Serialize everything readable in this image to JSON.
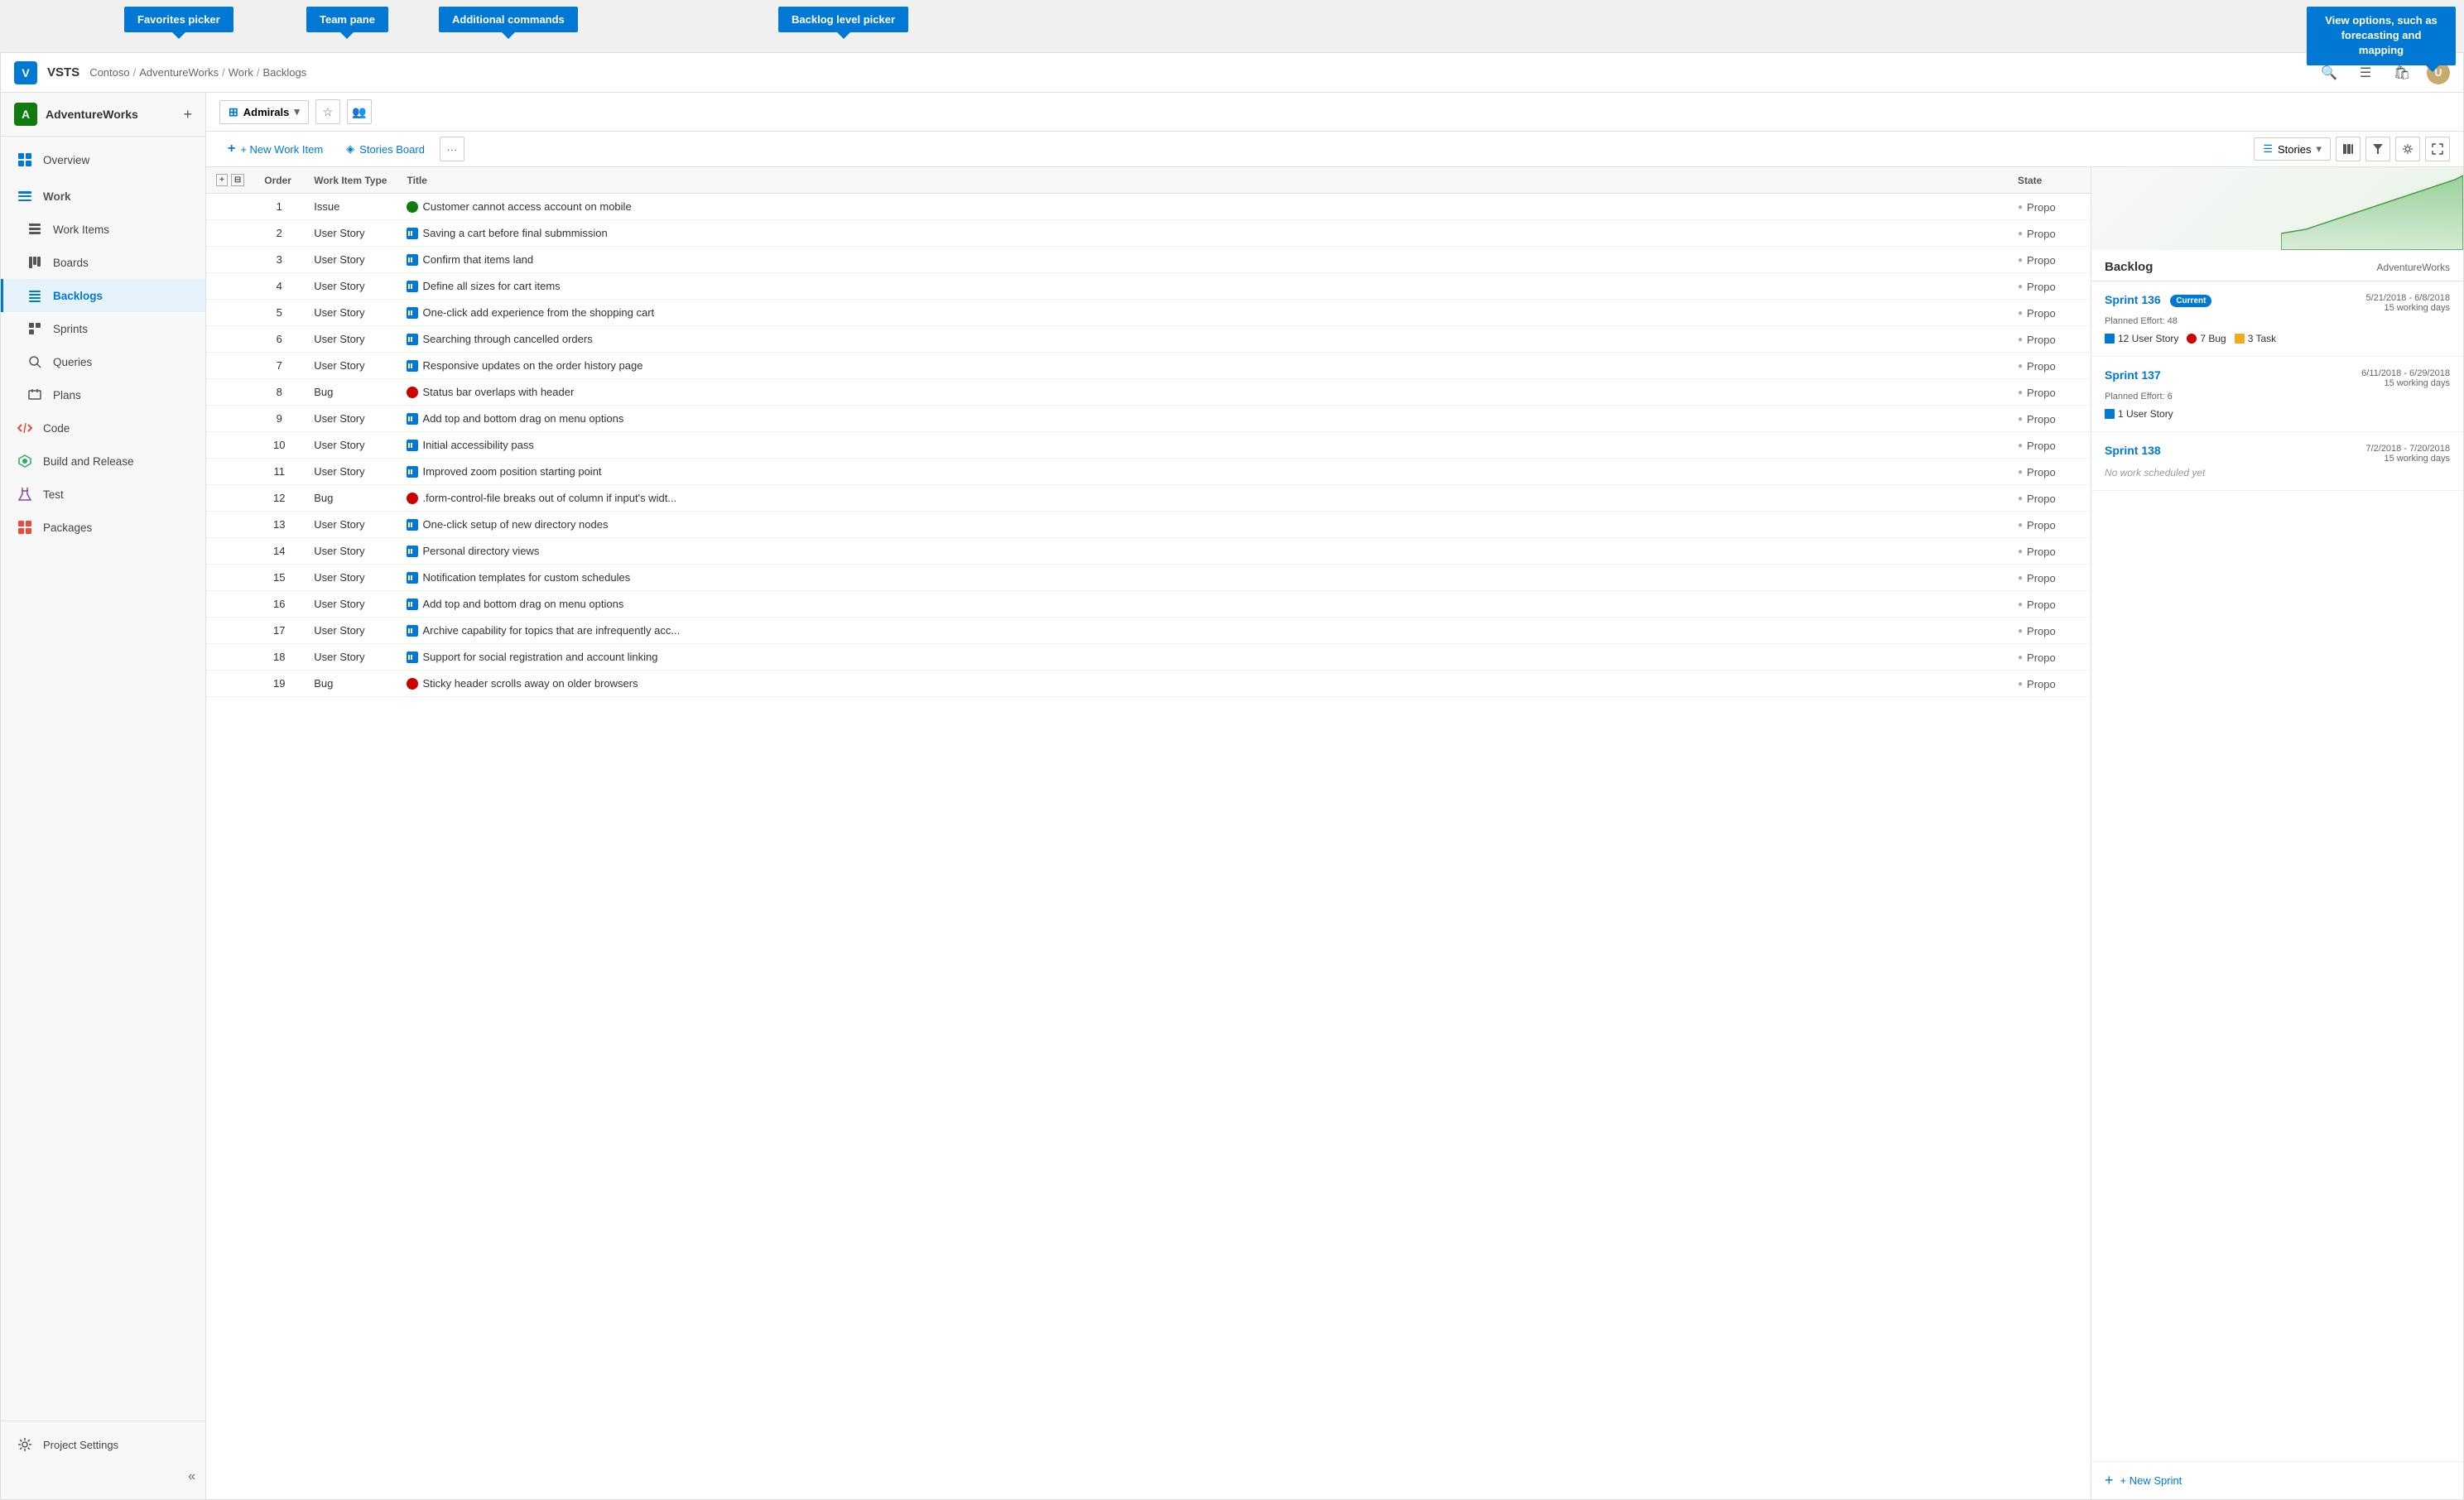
{
  "callouts": {
    "favorites": "Favorites picker",
    "team": "Team pane",
    "additional": "Additional commands",
    "backlog_picker": "Backlog level picker",
    "view_options": "View options, such as forecasting and mapping"
  },
  "header": {
    "logo_text": "V",
    "app_title": "VSTS",
    "breadcrumb": [
      "Contoso",
      "AdventureWorks",
      "Work",
      "Backlogs"
    ],
    "breadcrumb_sep": "/"
  },
  "team_selector": {
    "name": "Admirals",
    "chevron": "▾"
  },
  "action_bar": {
    "new_work_item": "+ New Work Item",
    "stories_board": "Stories Board",
    "more": "···",
    "stories_label": "Stories",
    "chevron": "▾"
  },
  "table": {
    "columns": [
      "",
      "Order",
      "Work Item Type",
      "Title",
      "State"
    ],
    "rows": [
      {
        "order": 1,
        "type": "Issue",
        "type_class": "issue",
        "title": "Customer cannot access account on mobile",
        "state": "Propo"
      },
      {
        "order": 2,
        "type": "User Story",
        "type_class": "us",
        "title": "Saving a cart before final submmission",
        "state": "Propo"
      },
      {
        "order": 3,
        "type": "User Story",
        "type_class": "us",
        "title": "Confirm that items land",
        "state": "Propo"
      },
      {
        "order": 4,
        "type": "User Story",
        "type_class": "us",
        "title": "Define all sizes for cart items",
        "state": "Propo"
      },
      {
        "order": 5,
        "type": "User Story",
        "type_class": "us",
        "title": "One-click add experience from the shopping cart",
        "state": "Propo"
      },
      {
        "order": 6,
        "type": "User Story",
        "type_class": "us",
        "title": "Searching through cancelled orders",
        "state": "Propo"
      },
      {
        "order": 7,
        "type": "User Story",
        "type_class": "us",
        "title": "Responsive updates on the order history page",
        "state": "Propo"
      },
      {
        "order": 8,
        "type": "Bug",
        "type_class": "bug",
        "title": "Status bar overlaps with header",
        "state": "Propo"
      },
      {
        "order": 9,
        "type": "User Story",
        "type_class": "us",
        "title": "Add top and bottom drag on menu options",
        "state": "Propo"
      },
      {
        "order": 10,
        "type": "User Story",
        "type_class": "us",
        "title": "Initial accessibility pass",
        "state": "Propo"
      },
      {
        "order": 11,
        "type": "User Story",
        "type_class": "us",
        "title": "Improved zoom position starting point",
        "state": "Propo"
      },
      {
        "order": 12,
        "type": "Bug",
        "type_class": "bug",
        "title": ".form-control-file breaks out of column if input's widt...",
        "state": "Propo"
      },
      {
        "order": 13,
        "type": "User Story",
        "type_class": "us",
        "title": "One-click setup of new directory nodes",
        "state": "Propo"
      },
      {
        "order": 14,
        "type": "User Story",
        "type_class": "us",
        "title": "Personal directory views",
        "state": "Propo"
      },
      {
        "order": 15,
        "type": "User Story",
        "type_class": "us",
        "title": "Notification templates for custom schedules",
        "state": "Propo"
      },
      {
        "order": 16,
        "type": "User Story",
        "type_class": "us",
        "title": "Add top and bottom drag on menu options",
        "state": "Propo"
      },
      {
        "order": 17,
        "type": "User Story",
        "type_class": "us",
        "title": "Archive capability for topics that are infrequently acc...",
        "state": "Propo"
      },
      {
        "order": 18,
        "type": "User Story",
        "type_class": "us",
        "title": "Support for social registration and account linking",
        "state": "Propo"
      },
      {
        "order": 19,
        "type": "Bug",
        "type_class": "bug",
        "title": "Sticky header scrolls away on older browsers",
        "state": "Propo"
      }
    ]
  },
  "sidebar": {
    "project_initial": "A",
    "project_name": "AdventureWorks",
    "nav_items": [
      {
        "id": "overview",
        "label": "Overview",
        "icon": "⊞",
        "active": false
      },
      {
        "id": "work",
        "label": "Work",
        "icon": "◈",
        "active": false,
        "is_section": true
      },
      {
        "id": "work-items",
        "label": "Work Items",
        "icon": "☰",
        "active": false,
        "indent": true
      },
      {
        "id": "boards",
        "label": "Boards",
        "icon": "⊞",
        "active": false,
        "indent": true
      },
      {
        "id": "backlogs",
        "label": "Backlogs",
        "icon": "≡",
        "active": true,
        "indent": true
      },
      {
        "id": "sprints",
        "label": "Sprints",
        "icon": "◱",
        "active": false,
        "indent": true
      },
      {
        "id": "queries",
        "label": "Queries",
        "icon": "⊟",
        "active": false,
        "indent": true
      },
      {
        "id": "plans",
        "label": "Plans",
        "icon": "◫",
        "active": false,
        "indent": true
      },
      {
        "id": "code",
        "label": "Code",
        "icon": "⊕",
        "active": false
      },
      {
        "id": "build-release",
        "label": "Build and Release",
        "icon": "⚙",
        "active": false
      },
      {
        "id": "test",
        "label": "Test",
        "icon": "⊘",
        "active": false
      },
      {
        "id": "packages",
        "label": "Packages",
        "icon": "◰",
        "active": false
      }
    ],
    "project_settings": "Project Settings",
    "collapse_icon": "«"
  },
  "right_panel": {
    "title": "Backlog",
    "project_name": "AdventureWorks",
    "sprints": [
      {
        "name": "Sprint 136",
        "is_current": true,
        "current_label": "Current",
        "planned_effort": "Planned Effort: 48",
        "dates": "5/21/2018 - 6/8/2018",
        "working_days": "15 working days",
        "tags": [
          {
            "type": "us",
            "count": 12,
            "label": "User Story"
          },
          {
            "type": "bug",
            "count": 7,
            "label": "Bug"
          },
          {
            "type": "task",
            "count": 3,
            "label": "Task"
          }
        ]
      },
      {
        "name": "Sprint 137",
        "is_current": false,
        "planned_effort": "Planned Effort: 6",
        "dates": "6/11/2018 - 6/29/2018",
        "working_days": "15 working days",
        "tags": [
          {
            "type": "us",
            "count": 1,
            "label": "User Story"
          }
        ]
      },
      {
        "name": "Sprint 138",
        "is_current": false,
        "planned_effort": "",
        "dates": "7/2/2018 - 7/20/2018",
        "working_days": "15 working days",
        "no_work": "No work scheduled yet",
        "tags": []
      }
    ],
    "new_sprint_label": "+ New Sprint"
  }
}
